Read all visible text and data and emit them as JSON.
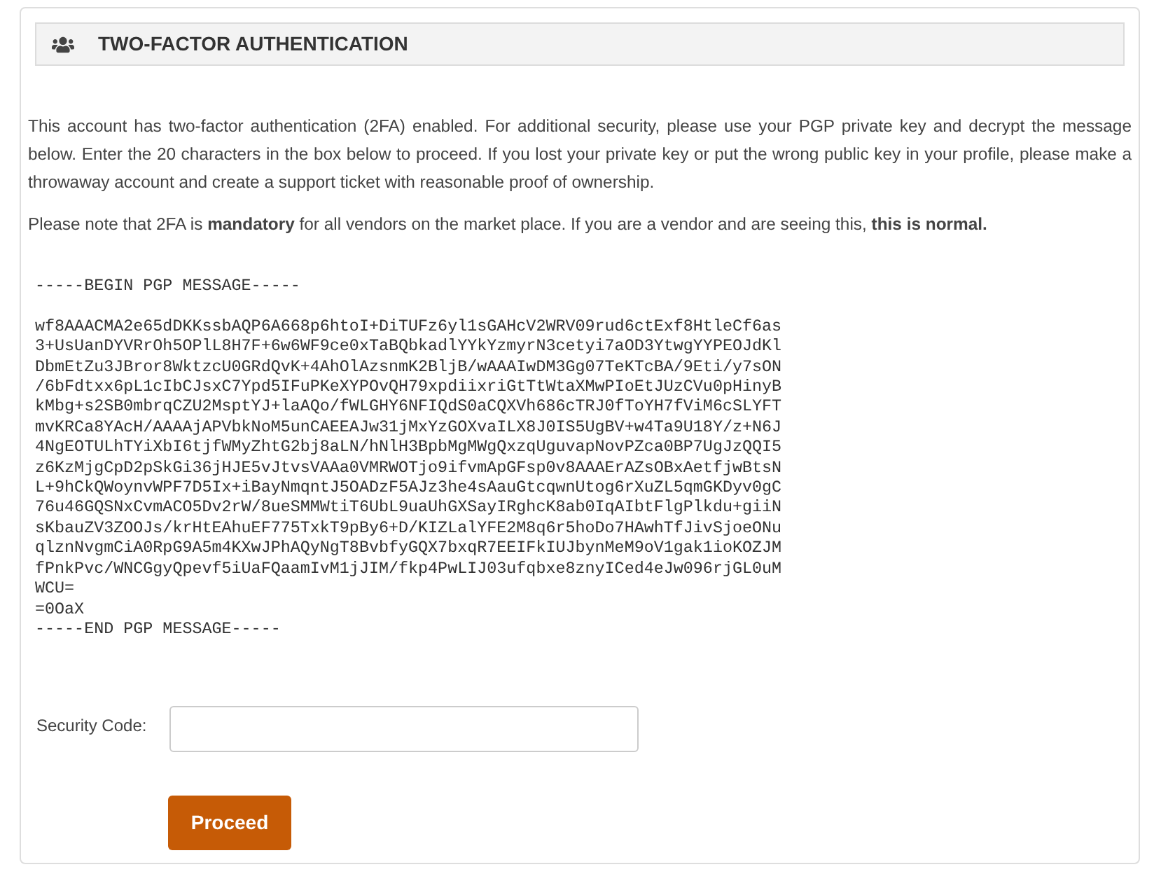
{
  "header": {
    "title": "TWO-FACTOR AUTHENTICATION"
  },
  "intro": {
    "paragraphs": [
      "This account has two-factor authentication (2FA) enabled. For additional security, please use your PGP private key and decrypt the message below. Enter the 20 characters in the box below to proceed. If you lost your private key or put the wrong public key in your profile, please make a throwaway account and create a support ticket with reasonable proof of ownership.",
      "Please note that 2FA is **mandatory** for all vendors on the market place. If you are a vendor and are seeing this, **this is normal.**"
    ]
  },
  "pgp_message": {
    "begin": "-----BEGIN PGP MESSAGE-----",
    "body": [
      "wf8AAACMA2e65dDKKssbAQP6A668p6htoI+DiTUFz6yl1sGAHcV2WRV09rud6ctExf8HtleCf6as",
      "3+UsUanDYVRrOh5OPlL8H7F+6w6WF9ce0xTaBQbkadlYYkYzmyrN3cetyi7aOD3YtwgYYPEOJdKl",
      "DbmEtZu3JBror8WktzcU0GRdQvK+4AhOlAzsnmK2BljB/wAAAIwDM3Gg07TeKTcBA/9Eti/y7sON",
      "/6bFdtxx6pL1cIbCJsxC7Ypd5IFuPKeXYPOvQH79xpdiixriGtTtWtaXMwPIoEtJUzCVu0pHinyB",
      "kMbg+s2SB0mbrqCZU2MsptYJ+laAQo/fWLGHY6NFIQdS0aCQXVh686cTRJ0fToYH7fViM6cSLYFT",
      "mvKRCa8YAcH/AAAAjAPVbkNoM5unCAEEAJw31jMxYzGOXvaILX8J0IS5UgBV+w4Ta9U18Y/z+N6J",
      "4NgEOTULhTYiXbI6tjfWMyZhtG2bj8aLN/hNlH3BpbMgMWgQxzqUguvapNovPZca0BP7UgJzQQI5",
      "z6KzMjgCpD2pSkGi36jHJE5vJtvsVAAa0VMRWOTjo9ifvmApGFsp0v8AAAErAZsOBxAetfjwBtsN",
      "L+9hCkQWoynvWPF7D5Ix+iBayNmqntJ5OADzF5AJz3he4sAauGtcqwnUtog6rXuZL5qmGKDyv0gC",
      "76u46GQSNxCvmACO5Dv2rW/8ueSMMWtiT6UbL9uaUhGXSayIRghcK8ab0IqAIbtFlgPlkdu+giiN",
      "sKbauZV3ZOOJs/krHtEAhuEF775TxkT9pBy6+D/KIZLalYFE2M8q6r5hoDo7HAwhTfJivSjoeONu",
      "qlznNvgmCiA0RpG9A5m4KXwJPhAQyNgT8BvbfyGQX7bxqR7EEIFkIUJbynMeM9oV1gak1ioKOZJM",
      "fPnkPvc/WNCGgyQpevf5iUaFQaamIvM1jJIM/fkp4PwLIJ03ufqbxe8znyICed4eJw096rjGL0uM",
      "WCU=",
      "=0OaX"
    ],
    "end": "-----END PGP MESSAGE-----"
  },
  "form": {
    "security_code": {
      "label": "Security Code:"
    },
    "submit_button": {
      "label": "Proceed"
    }
  }
}
